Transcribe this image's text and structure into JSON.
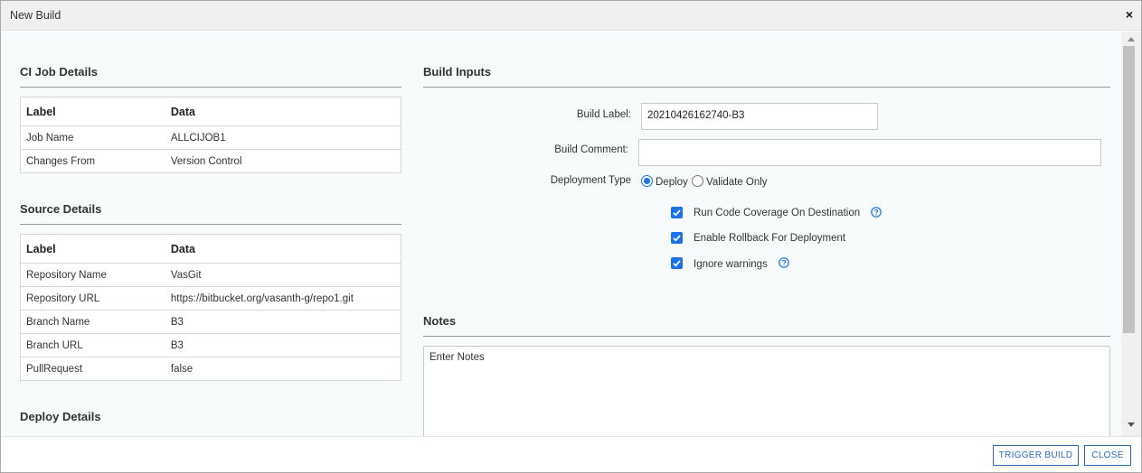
{
  "dialog": {
    "title": "New Build",
    "close_label": "×"
  },
  "ci_job": {
    "title": "CI Job Details",
    "headers": [
      "Label",
      "Data"
    ],
    "rows": [
      [
        "Job Name",
        "ALLCIJOB1"
      ],
      [
        "Changes From",
        "Version Control"
      ]
    ]
  },
  "source": {
    "title": "Source Details",
    "headers": [
      "Label",
      "Data"
    ],
    "rows": [
      [
        "Repository Name",
        "VasGit"
      ],
      [
        "Repository URL",
        "https://bitbucket.org/vasanth-g/repo1.git"
      ],
      [
        "Branch Name",
        "B3"
      ],
      [
        "Branch URL",
        "B3"
      ],
      [
        "PullRequest",
        "false"
      ]
    ]
  },
  "deploy": {
    "title": "Deploy Details"
  },
  "build_inputs": {
    "title": "Build Inputs",
    "build_label_label": "Build Label:",
    "build_label_value": "20210426162740-B3",
    "build_comment_label": "Build Comment:",
    "build_comment_value": "",
    "deployment_type_label": "Deployment Type",
    "radio_deploy": "Deploy",
    "radio_validate": "Validate Only",
    "selected_deployment": "Deploy",
    "checkboxes": [
      {
        "label": "Run Code Coverage On Destination",
        "checked": true,
        "help": true
      },
      {
        "label": "Enable Rollback For Deployment",
        "checked": true,
        "help": false
      },
      {
        "label": "Ignore warnings",
        "checked": true,
        "help": true
      }
    ]
  },
  "notes": {
    "title": "Notes",
    "placeholder": "Enter Notes"
  },
  "footer": {
    "trigger_label": "TRIGGER BUILD",
    "close_label": "CLOSE"
  },
  "colors": {
    "accent": "#1a73e8",
    "button_border": "#2b6cb0",
    "titlebar": "#f0f0f0",
    "body_bg": "#f8fbfb"
  }
}
